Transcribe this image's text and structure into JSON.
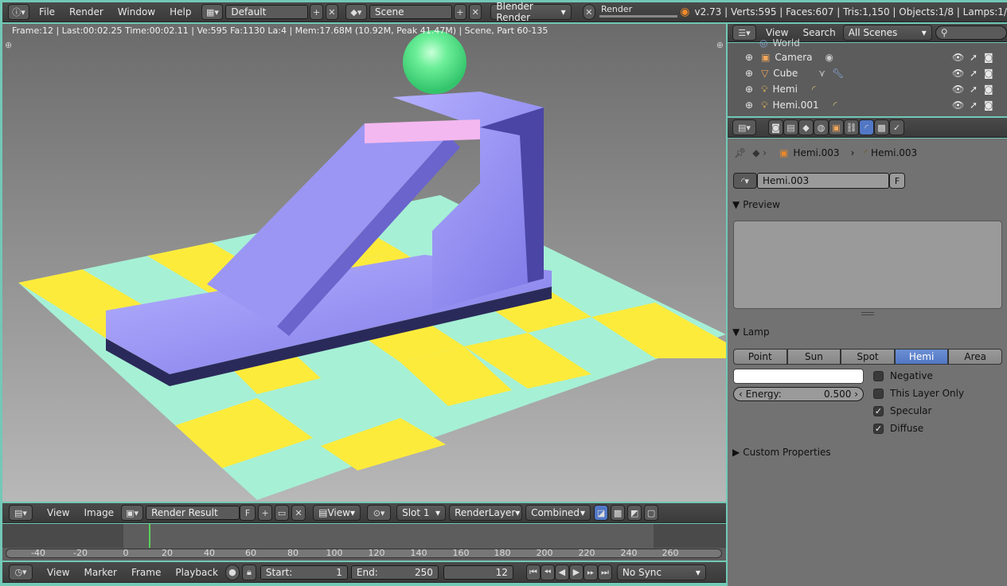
{
  "top_bar": {
    "menus": [
      "File",
      "Render",
      "Window",
      "Help"
    ],
    "layout_field": "Default",
    "scene_field": "Scene",
    "engine": "Blender Render",
    "progress_label": "Render",
    "stats": "v2.73 | Verts:595 | Faces:607 | Tris:1,150 | Objects:1/8 | Lamps:1/"
  },
  "viewport": {
    "info": "Frame:12 | Last:00:02.25 Time:00:02.11 | Ve:595 Fa:1130 La:4 | Mem:17.68M (10.92M, Peak 41.47M) | Scene, Part 60-135"
  },
  "outliner": {
    "view_label": "View",
    "search_label": "Search",
    "scenes_select": "All Scenes",
    "partial_item": "World",
    "items": [
      "Camera",
      "Cube",
      "Hemi",
      "Hemi.001"
    ]
  },
  "properties": {
    "breadcrumb_obj": "Hemi.003",
    "breadcrumb_data": "Hemi.003",
    "datablock_name": "Hemi.003",
    "fake_user": "F",
    "preview_header": "Preview",
    "lamp_header": "Lamp",
    "lamp_types": [
      "Point",
      "Sun",
      "Spot",
      "Hemi",
      "Area"
    ],
    "active_type": "Hemi",
    "energy_label": "Energy:",
    "energy_value": "0.500",
    "options": [
      {
        "label": "Negative",
        "checked": false
      },
      {
        "label": "This Layer Only",
        "checked": false
      },
      {
        "label": "Specular",
        "checked": true
      },
      {
        "label": "Diffuse",
        "checked": true
      }
    ],
    "custom_props_header": "Custom Properties",
    "color_swatch": "#ffffff"
  },
  "image_header": {
    "view_label": "View",
    "image_label": "Image",
    "image_name": "Render Result",
    "fake_user": "F",
    "view_select": "View",
    "slot": "Slot 1",
    "render_layer": "RenderLayer",
    "pass": "Combined"
  },
  "timeline": {
    "ticks": [
      "-40",
      "-20",
      "0",
      "20",
      "40",
      "60",
      "80",
      "100",
      "120",
      "140",
      "160",
      "180",
      "200",
      "220",
      "240",
      "260"
    ],
    "current_frame_marker": 12,
    "view_label": "View",
    "marker_label": "Marker",
    "frame_label": "Frame",
    "playback_label": "Playback",
    "start_label": "Start:",
    "start_value": "1",
    "end_label": "End:",
    "end_value": "250",
    "current_frame": "12",
    "sync": "No Sync"
  },
  "colors": {
    "accent_blue": "#5277c4",
    "viewport_top": "#6e6e6e",
    "viewport_bottom": "#bdbdbd",
    "checker_yellow": "#fdeb3c",
    "checker_mint": "#a6f0d6",
    "object_lavender": "#9a95f0",
    "sphere_green": "#5fe88f"
  }
}
